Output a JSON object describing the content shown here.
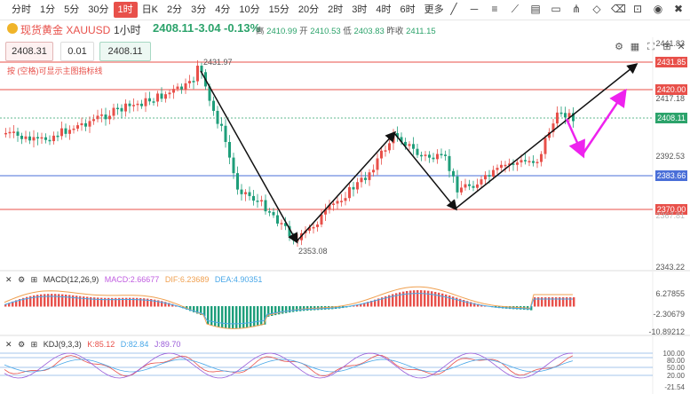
{
  "timeframes": [
    "分时",
    "1分",
    "5分",
    "30分",
    "1时",
    "日K",
    "2分",
    "3分",
    "4分",
    "10分",
    "15分",
    "20分",
    "2时",
    "3时",
    "4时",
    "6时",
    "更多"
  ],
  "active_timeframe_index": 4,
  "symbol": {
    "name": "现货黄金 XAUUSD",
    "interval": "1小时",
    "last": "2408.11",
    "change": "-3.04",
    "change_pct": "-0.13%"
  },
  "ohlc": {
    "high_label": "高",
    "high": "2410.99",
    "open_label": "开",
    "open": "2410.53",
    "low_label": "低",
    "low": "2403.83",
    "prev_label": "昨收",
    "prev": "2411.15"
  },
  "order": {
    "sell": "2408.31",
    "qty": "0.01",
    "buy": "2408.11"
  },
  "note": "按 (空格)可显示主图指标线",
  "price_axis": [
    "2441.83",
    "2431.85",
    "2420.00",
    "2417.18",
    "2408.11",
    "2392.53",
    "2383.66",
    "2370.00",
    "2367.81",
    "2343.22"
  ],
  "annotations": {
    "high": "2431.97",
    "low": "2353.08"
  },
  "macd": {
    "title": "MACD(12,26,9)",
    "macd": "MACD:2.66677",
    "dif": "DIF:6.23689",
    "dea": "DEA:4.90351",
    "axis": [
      "6.27855",
      "-2.30679",
      "-10.89212"
    ]
  },
  "kdj": {
    "title": "KDJ(9,3,3)",
    "k": "K:85.12",
    "d": "D:82.84",
    "j": "J:89.70",
    "axis": [
      "100.00",
      "80.00",
      "50.00",
      "20.00",
      "-21.54"
    ]
  },
  "colors": {
    "up": "#e8504a",
    "down": "#1e9e7a",
    "accent": "#e8504a",
    "magenta": "#ee22ee"
  }
}
